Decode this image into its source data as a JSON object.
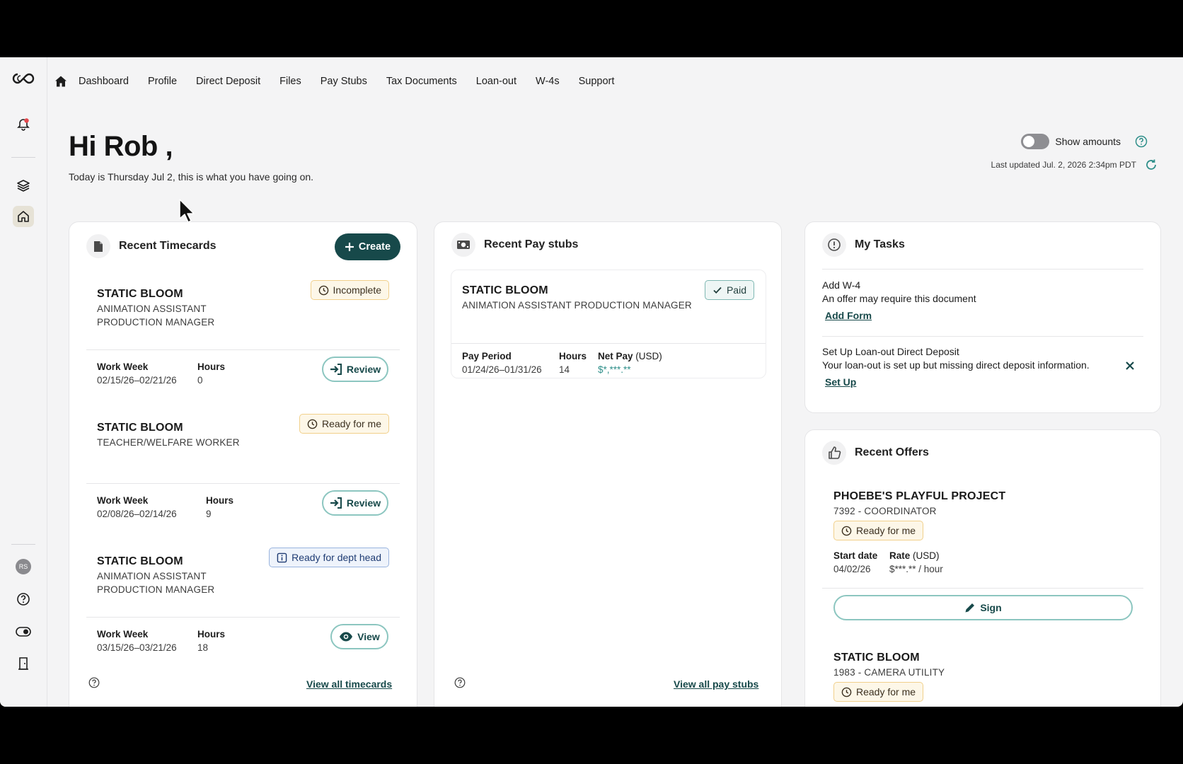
{
  "nav": {
    "items": [
      "Dashboard",
      "Profile",
      "Direct Deposit",
      "Files",
      "Pay Stubs",
      "Tax Documents",
      "Loan-out",
      "W-4s",
      "Support"
    ]
  },
  "rail": {
    "avatar_initials": "RS"
  },
  "header": {
    "greeting": "Hi Rob ,",
    "subtitle": "Today is Thursday Jul 2, this is what you have going on.",
    "show_amounts_label": "Show amounts",
    "last_updated": "Last updated Jul. 2, 2026 2:34pm PDT"
  },
  "timecards": {
    "title": "Recent Timecards",
    "create_label": "Create",
    "week_label": "Work Week",
    "hours_label": "Hours",
    "items": [
      {
        "project": "STATIC BLOOM",
        "role_line1": "ANIMATION ASSISTANT",
        "role_line2": "PRODUCTION MANAGER",
        "status": "Incomplete",
        "week": "02/15/26–02/21/26",
        "hours": "0",
        "action": "Review"
      },
      {
        "project": "STATIC BLOOM",
        "role_line1": "TEACHER/WELFARE WORKER",
        "role_line2": "",
        "status": "Ready for me",
        "week": "02/08/26–02/14/26",
        "hours": "9",
        "action": "Review"
      },
      {
        "project": "STATIC BLOOM",
        "role_line1": "ANIMATION ASSISTANT",
        "role_line2": "PRODUCTION MANAGER",
        "status": "Ready for dept head",
        "week": "03/15/26–03/21/26",
        "hours": "18",
        "action": "View"
      }
    ],
    "view_all": "View all timecards"
  },
  "paystubs": {
    "title": "Recent Pay stubs",
    "items": [
      {
        "project": "STATIC BLOOM",
        "role": "ANIMATION ASSISTANT PRODUCTION MANAGER",
        "status": "Paid",
        "period_label": "Pay Period",
        "period": "01/24/26–01/31/26",
        "hours_label": "Hours",
        "hours": "14",
        "netpay_label": "Net Pay",
        "netpay_unit": "(USD)",
        "netpay": "$*,***.**"
      }
    ],
    "view_all": "View all pay stubs"
  },
  "tasks": {
    "title": "My Tasks",
    "items": [
      {
        "title": "Add W-4",
        "desc": "An offer may require this document",
        "action": "Add Form"
      },
      {
        "title": "Set Up Loan-out Direct Deposit",
        "desc": "Your loan-out is set up but missing direct deposit information.",
        "action": "Set Up"
      }
    ]
  },
  "offers": {
    "title": "Recent Offers",
    "start_label": "Start date",
    "rate_label": "Rate",
    "rate_unit": "(USD)",
    "items": [
      {
        "project": "PHOEBE'S PLAYFUL PROJECT",
        "role": "7392 - COORDINATOR",
        "status": "Ready for me",
        "start": "04/02/26",
        "rate": "$***.** / hour",
        "action": "Sign"
      },
      {
        "project": "STATIC BLOOM",
        "role": "1983 - CAMERA UTILITY",
        "status": "Ready for me"
      }
    ]
  },
  "colors": {
    "accent": "#17494a",
    "accent_light": "#8cc6c0",
    "warn": "#f1d08b",
    "info": "#9ab4de",
    "notify": "#e5484d"
  }
}
